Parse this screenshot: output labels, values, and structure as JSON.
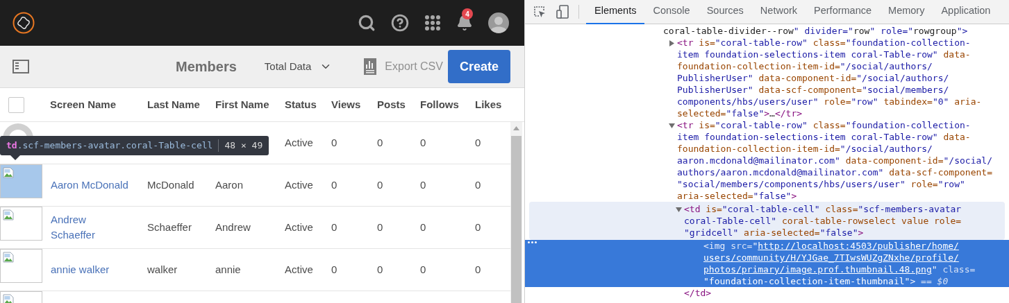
{
  "app": {
    "notifications_badge": "4",
    "toolbar": {
      "title": "Members",
      "filter": "Total Data",
      "export": {
        "label": "Export CSV",
        "disabled": true
      },
      "create": "Create"
    },
    "table": {
      "select_all_checked": false,
      "columns": [
        "Screen Name",
        "Last Name",
        "First Name",
        "Status",
        "Views",
        "Posts",
        "Follows",
        "Likes"
      ],
      "rows": [
        {
          "kind": "photo",
          "highlighted": false,
          "status": "Active",
          "views": "0",
          "posts": "0",
          "follows": "0",
          "likes": "0"
        },
        {
          "kind": "broken-image",
          "highlighted": true,
          "screen_name": "Aaron McDonald",
          "last_name": "McDonald",
          "first_name": "Aaron",
          "status": "Active",
          "views": "0",
          "posts": "0",
          "follows": "0",
          "likes": "0"
        },
        {
          "kind": "broken-image",
          "highlighted": false,
          "screen_name": "Andrew Schaeffer",
          "last_name": "Schaeffer",
          "first_name": "Andrew",
          "status": "Active",
          "views": "0",
          "posts": "0",
          "follows": "0",
          "likes": "0"
        },
        {
          "kind": "broken-image",
          "highlighted": false,
          "screen_name": "annie walker",
          "last_name": "walker",
          "first_name": "annie",
          "status": "Active",
          "views": "0",
          "posts": "0",
          "follows": "0",
          "likes": "0"
        },
        {
          "kind": "broken-image",
          "highlighted": false
        }
      ]
    },
    "inspect_tooltip": {
      "tag": "td",
      "classes": ".scf-members-avatar.coral-Table-cell",
      "size": "48 × 49"
    }
  },
  "devtools": {
    "tabs": [
      {
        "label": "Elements",
        "selected": true
      },
      {
        "label": "Console",
        "selected": false
      },
      {
        "label": "Sources",
        "selected": false
      },
      {
        "label": "Network",
        "selected": false
      },
      {
        "label": "Performance",
        "selected": false
      },
      {
        "label": "Memory",
        "selected": false
      },
      {
        "label": "Application",
        "selected": false
      }
    ],
    "elements_tree": [
      {
        "kind": "fragment",
        "lines": [
          "coral-table-divider--row\" divider=\"row\" role=\"rowgroup\">"
        ]
      },
      {
        "kind": "element",
        "expanded": false,
        "hovered": false,
        "selected": false,
        "lines": [
          "<tr is=\"coral-table-row\" class=\"foundation-collection-",
          "item foundation-selections-item coral-Table-row\" data-",
          "foundation-collection-item-id=\"/social/authors/",
          "PublisherUser\" data-component-id=\"/social/authors/",
          "PublisherUser\" data-scf-component=\"social/members/",
          "components/hbs/users/user\" role=\"row\" tabindex=\"0\" aria-",
          "selected=\"false\">…</tr>"
        ]
      },
      {
        "kind": "element",
        "expanded": true,
        "hovered": false,
        "selected": false,
        "lines": [
          "<tr is=\"coral-table-row\" class=\"foundation-collection-",
          "item foundation-selections-item coral-Table-row\" data-",
          "foundation-collection-item-id=\"/social/authors/",
          "aaron.mcdonald@mailinator.com\" data-component-id=\"/social/",
          "authors/aaron.mcdonald@mailinator.com\" data-scf-component=",
          "\"social/members/components/hbs/users/user\" role=\"row\"",
          "aria-selected=\"false\">"
        ],
        "children": [
          {
            "kind": "element",
            "expanded": true,
            "hovered": true,
            "selected": false,
            "lines": [
              "<td is=\"coral-table-cell\" class=\"scf-members-avatar",
              "coral-Table-cell\" coral-table-rowselect value role=",
              "\"gridcell\" aria-selected=\"false\">"
            ],
            "closing": "</td>",
            "children": [
              {
                "kind": "element",
                "hovered": false,
                "selected": true,
                "lines": [
                  "<img src=\"http://localhost:4503/publisher/home/",
                  "users/community/H/YJGae_7TIwsWUZgZNxhe/profile/",
                  "photos/primary/image.prof.thumbnail.48.png\" class=",
                  "\"foundation-collection-item-thumbnail\"> == $0"
                ]
              }
            ]
          }
        ]
      }
    ]
  }
}
